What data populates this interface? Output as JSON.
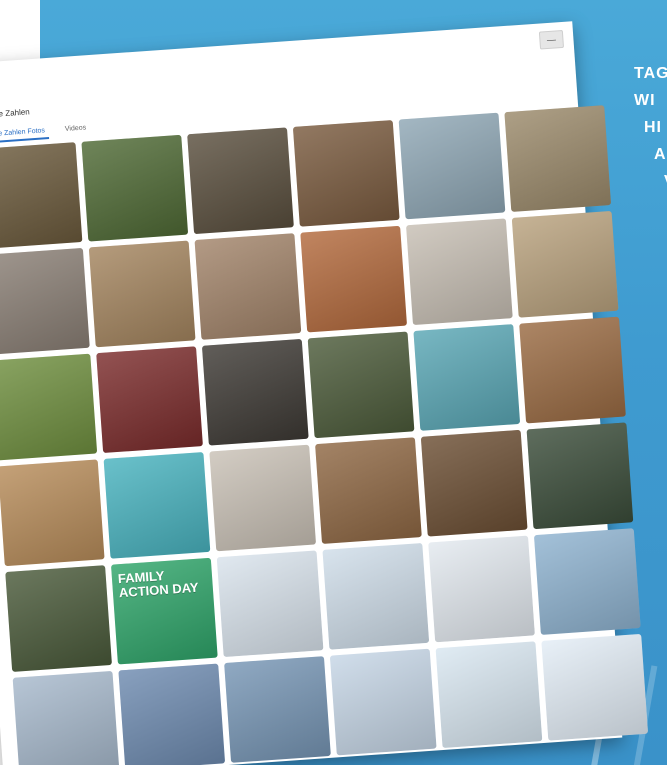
{
  "window": {
    "title": "ohne Zahlen",
    "close_label": "—",
    "tabs": [
      {
        "label": "ohne Zahlen Fotos",
        "active": true
      },
      {
        "label": "Videos",
        "active": false
      }
    ]
  },
  "side_text": [
    "TAG",
    "WI",
    "HI",
    "AI",
    "V"
  ],
  "poster": {
    "line1": "FAMILY",
    "line2": "ACTION DAY"
  },
  "photos": [
    {
      "name": "tree-carving-photo",
      "color": "#6b5a3c"
    },
    {
      "name": "gnome-tree-photo",
      "color": "#4f6a35"
    },
    {
      "name": "tree-face-photo",
      "color": "#5a4f3e"
    },
    {
      "name": "woman-shop-photo",
      "color": "#7a5b3f"
    },
    {
      "name": "shelves-products-photo",
      "color": "#8fa7b5"
    },
    {
      "name": "jars-shelf-photo",
      "color": "#9b8a6b"
    },
    {
      "name": "cows-stable-photo",
      "color": "#8a7f75"
    },
    {
      "name": "woman-holding-jar-photo",
      "color": "#a4855f"
    },
    {
      "name": "brewery-kettle-photo",
      "color": "#a2846a"
    },
    {
      "name": "pretzels-photo",
      "color": "#b36a3d"
    },
    {
      "name": "sacks-photo",
      "color": "#c7bfb4"
    },
    {
      "name": "man-kitchen-photo",
      "color": "#b9a27e"
    },
    {
      "name": "farmer-field-photo",
      "color": "#6f8f3f"
    },
    {
      "name": "bottles-shelf-photo",
      "color": "#7b2c2c"
    },
    {
      "name": "copper-pot-photo",
      "color": "#3e3a35"
    },
    {
      "name": "plant-heart-photo",
      "color": "#4c5b3a"
    },
    {
      "name": "bottles-turquoise-photo",
      "color": "#5aa7b5"
    },
    {
      "name": "wood-room-photo",
      "color": "#9a6b43"
    },
    {
      "name": "shop-ceramics-photo",
      "color": "#b78c5a"
    },
    {
      "name": "turquoise-bowls-photo",
      "color": "#49b3bf"
    },
    {
      "name": "white-pottery-photo",
      "color": "#c9c1b6"
    },
    {
      "name": "family-craft-photo",
      "color": "#8f6844"
    },
    {
      "name": "woman-pottery-photo",
      "color": "#6c4f34"
    },
    {
      "name": "forest-dark-photo",
      "color": "#3b4d3a"
    },
    {
      "name": "woman-greenhouse-photo",
      "color": "#4a5a3a"
    },
    {
      "name": "family-action-day-poster",
      "color": "#2fa56a",
      "poster": true
    },
    {
      "name": "kids-ski-lesson-photo",
      "color": "#d9e3ec"
    },
    {
      "name": "ski-kids-group-photo",
      "color": "#cfdde9"
    },
    {
      "name": "ski-kids-line-photo",
      "color": "#e3e9ef"
    },
    {
      "name": "mountain-snow-photo",
      "color": "#8fb3d0"
    },
    {
      "name": "lake-winter-photo",
      "color": "#a7b9cc"
    },
    {
      "name": "train-winter-photo",
      "color": "#6e8bb0"
    },
    {
      "name": "mountain-peaks-photo",
      "color": "#7796b5"
    },
    {
      "name": "snowy-field-photo",
      "color": "#c6d6e6"
    },
    {
      "name": "cross-country-ski-photo",
      "color": "#d9e7f1"
    },
    {
      "name": "skier-slope-photo",
      "color": "#e3edf6"
    }
  ]
}
